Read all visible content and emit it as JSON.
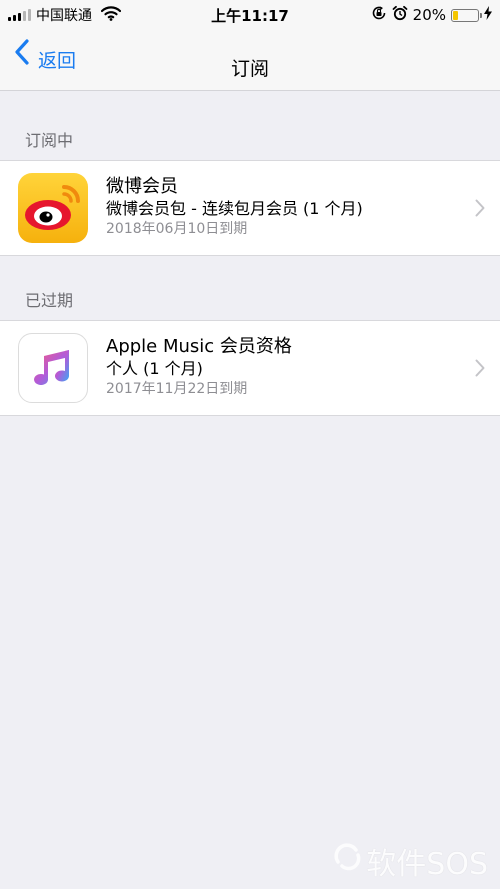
{
  "status_bar": {
    "carrier": "中国联通",
    "time": "上午11:17",
    "battery_text": "20%",
    "battery_level": 0.2,
    "battery_color": "#f5c600"
  },
  "nav": {
    "back_label": "返回",
    "title": "订阅"
  },
  "sections": {
    "active_header": "订阅中",
    "expired_header": "已过期"
  },
  "subscriptions": {
    "active": {
      "icon": "weibo-app-icon",
      "title": "微博会员",
      "plan": "微博会员包 - 连续包月会员 (1 个月)",
      "date": "2018年06月10日到期"
    },
    "expired": {
      "icon": "apple-music-app-icon",
      "title": "Apple Music 会员资格",
      "plan": "个人 (1 个月)",
      "date": "2017年11月22日到期"
    }
  },
  "colors": {
    "accent": "#1a7cf0",
    "background": "#efeff4"
  },
  "watermark": "软件SOS"
}
